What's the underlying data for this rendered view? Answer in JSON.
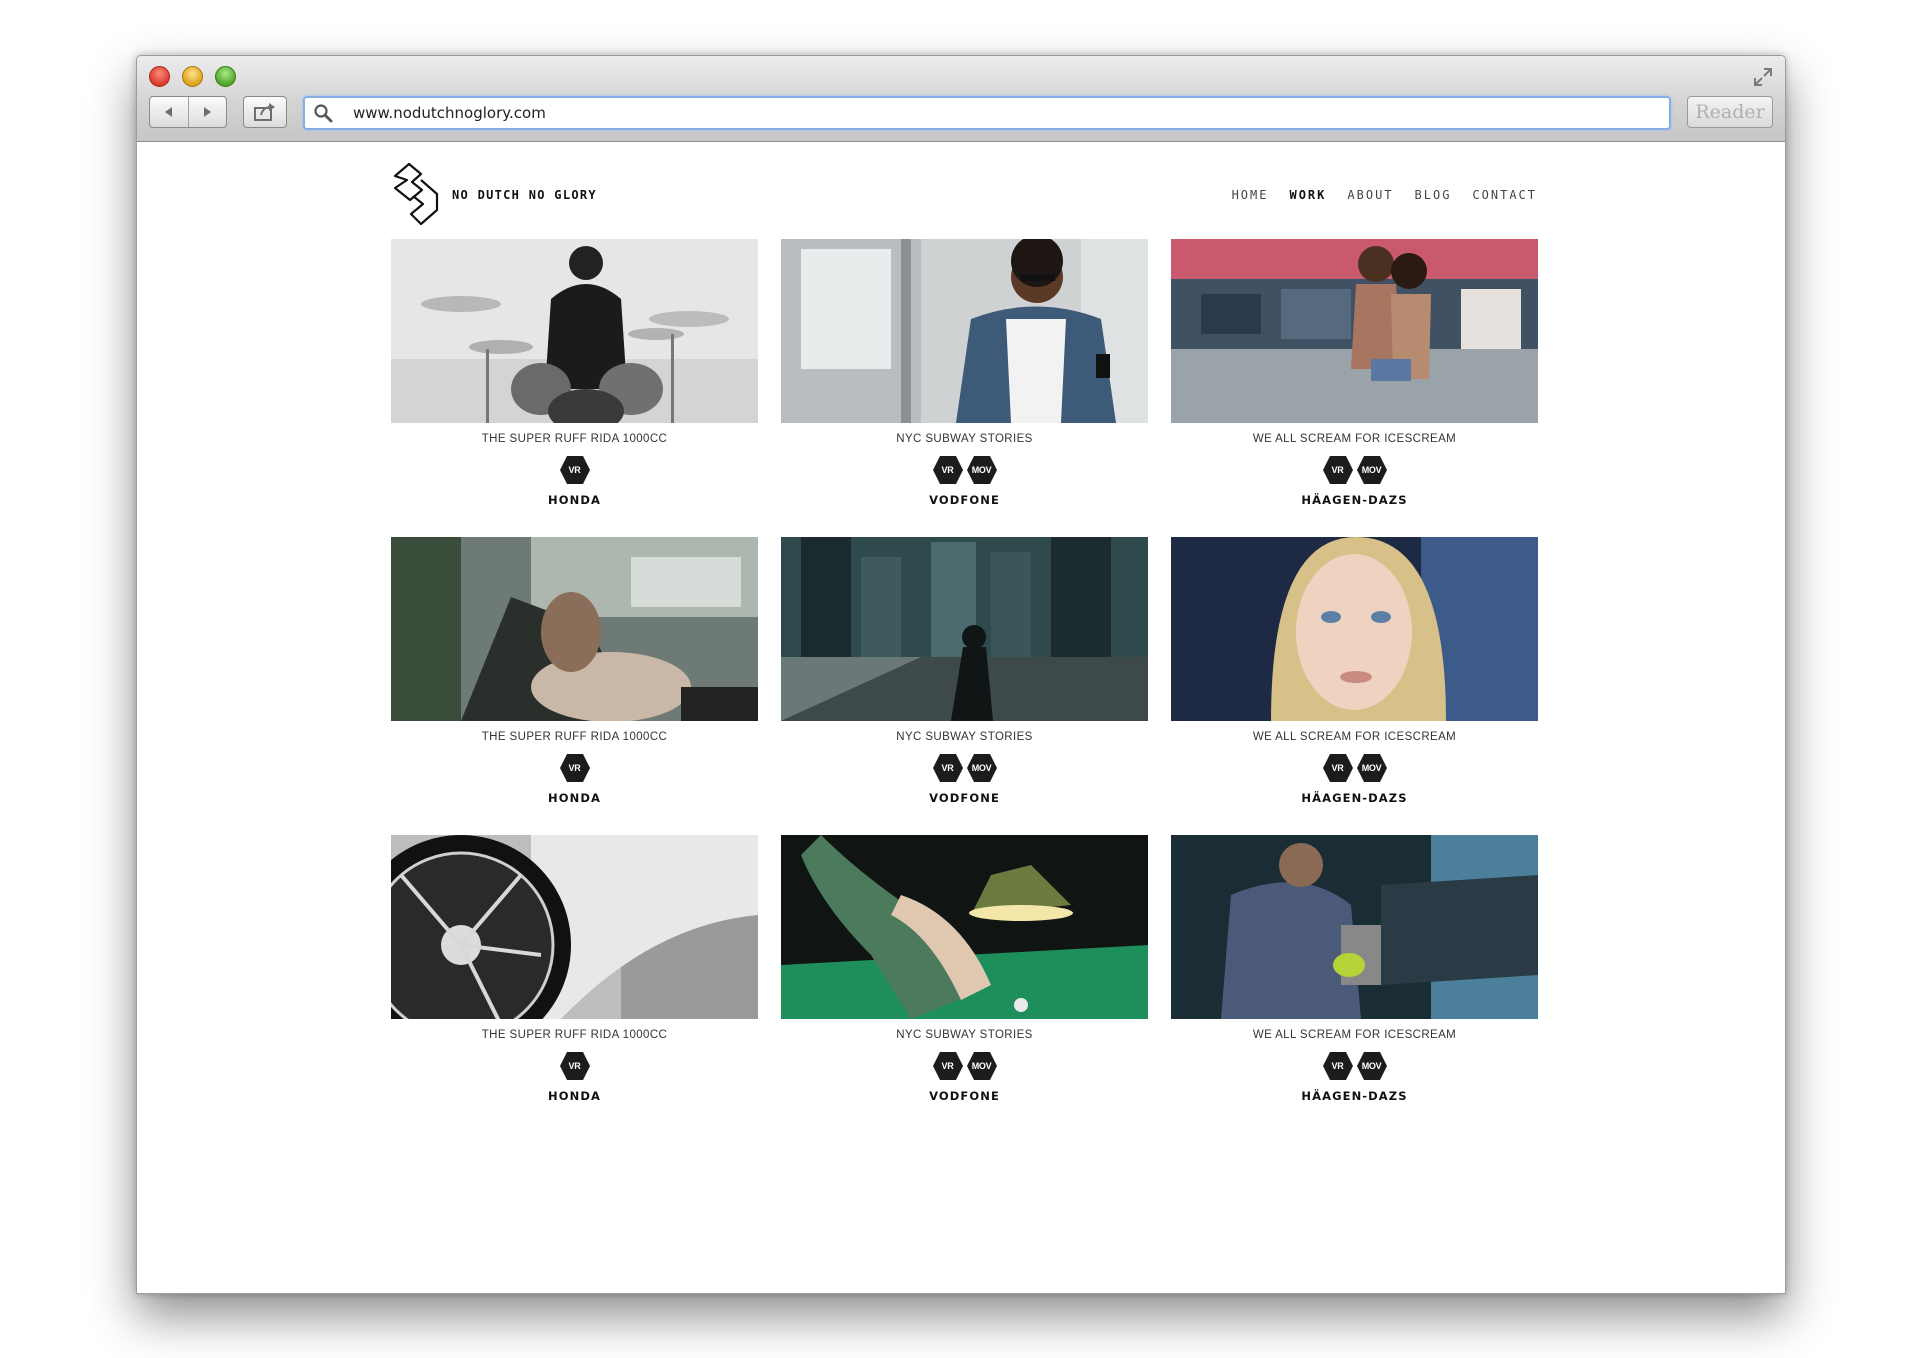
{
  "browser": {
    "url": "www.nodutchnoglory.com",
    "reader_label": "Reader"
  },
  "site": {
    "logo_text": "NO DUTCH NO GLORY",
    "nav": [
      {
        "label": "HOME",
        "active": false
      },
      {
        "label": "WORK",
        "active": true
      },
      {
        "label": "ABOUT",
        "active": false
      },
      {
        "label": "BLOG",
        "active": false
      },
      {
        "label": "CONTACT",
        "active": false
      }
    ]
  },
  "projects": [
    {
      "title": "THE SUPER RUFF RIDA 1000CC",
      "tags": [
        "VR"
      ],
      "client": "HONDA",
      "scene": "drummer"
    },
    {
      "title": "NYC SUBWAY STORIES",
      "tags": [
        "VR",
        "MOV"
      ],
      "client": "VODFONE",
      "scene": "subway"
    },
    {
      "title": "WE ALL SCREAM FOR ICESCREAM",
      "tags": [
        "VR",
        "MOV"
      ],
      "client": "HÄAGEN-DAZS",
      "scene": "street"
    },
    {
      "title": "THE SUPER RUFF RIDA 1000CC",
      "tags": [
        "VR"
      ],
      "client": "HONDA",
      "scene": "car-interior"
    },
    {
      "title": "NYC SUBWAY STORIES",
      "tags": [
        "VR",
        "MOV"
      ],
      "client": "VODFONE",
      "scene": "city"
    },
    {
      "title": "WE ALL SCREAM FOR ICESCREAM",
      "tags": [
        "VR",
        "MOV"
      ],
      "client": "HÄAGEN-DAZS",
      "scene": "portrait"
    },
    {
      "title": "THE SUPER RUFF RIDA 1000CC",
      "tags": [
        "VR"
      ],
      "client": "HONDA",
      "scene": "wheel"
    },
    {
      "title": "NYC SUBWAY STORIES",
      "tags": [
        "VR",
        "MOV"
      ],
      "client": "VODFONE",
      "scene": "pool"
    },
    {
      "title": "WE ALL SCREAM FOR ICESCREAM",
      "tags": [
        "VR",
        "MOV"
      ],
      "client": "HÄAGEN-DAZS",
      "scene": "espresso"
    }
  ],
  "colors": {
    "tag_fill": "#1c1c1c",
    "text_primary": "#111111",
    "address_focus": "#86aee5"
  }
}
